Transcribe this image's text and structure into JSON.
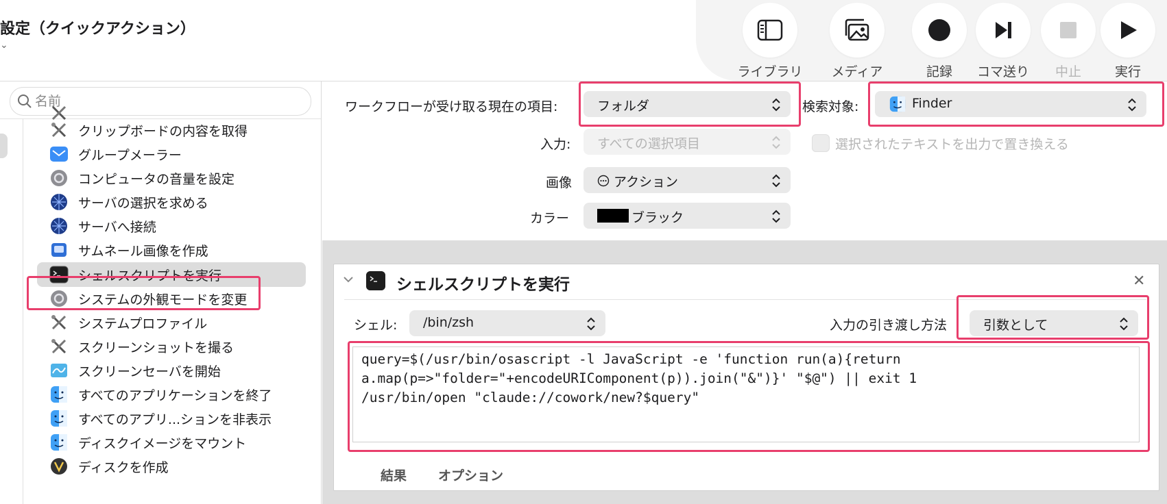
{
  "window": {
    "title": "設定（クイックアクション）",
    "subtitle": "⌄"
  },
  "toolbar": {
    "buttons": [
      {
        "label": "ライブラリ",
        "icon": "sidebar-icon"
      },
      {
        "label": "メディア",
        "icon": "photos-icon"
      },
      {
        "label": "記録",
        "icon": "record-icon"
      },
      {
        "label": "コマ送り",
        "icon": "step-icon"
      },
      {
        "label": "中止",
        "icon": "stop-icon",
        "disabled": true
      },
      {
        "label": "実行",
        "icon": "play-icon"
      }
    ]
  },
  "library": {
    "search_placeholder": "名前",
    "items": [
      {
        "label": "クリップボードの内容を取得",
        "icon": "utility-tools-icon"
      },
      {
        "label": "グループメーラー",
        "icon": "mail-icon"
      },
      {
        "label": "コンピュータの音量を設定",
        "icon": "system-preferences-icon"
      },
      {
        "label": "サーバの選択を求める",
        "icon": "network-globe-icon"
      },
      {
        "label": "サーバへ接続",
        "icon": "network-globe-icon"
      },
      {
        "label": "サムネール画像を作成",
        "icon": "preview-icon"
      },
      {
        "label": "シェルスクリプトを実行",
        "icon": "terminal-icon",
        "selected": true
      },
      {
        "label": "システムの外観モードを変更",
        "icon": "system-preferences-icon"
      },
      {
        "label": "システムプロファイル",
        "icon": "utility-tools-icon"
      },
      {
        "label": "スクリーンショットを撮る",
        "icon": "utility-tools-icon"
      },
      {
        "label": "スクリーンセーバを開始",
        "icon": "screensaver-icon"
      },
      {
        "label": "すべてのアプリケーションを終了",
        "icon": "finder-icon"
      },
      {
        "label": "すべてのアプリ...ションを非表示",
        "icon": "finder-icon"
      },
      {
        "label": "ディスクイメージをマウント",
        "icon": "finder-icon"
      },
      {
        "label": "ディスクを作成",
        "icon": "disk-utility-icon"
      }
    ]
  },
  "workflow": {
    "receives_label": "ワークフローが受け取る現在の項目:",
    "receives_value": "フォルダ",
    "in_label": "検索対象:",
    "in_value": "Finder",
    "input_label": "入力:",
    "input_value": "すべての選択項目",
    "replace_label": "選択されたテキストを出力で置き換える",
    "image_label": "画像",
    "image_value": "アクション",
    "color_label": "カラー",
    "color_value": "ブラック",
    "color_swatch": "#000000"
  },
  "action": {
    "title": "シェルスクリプトを実行",
    "shell_label": "シェル:",
    "shell_value": "/bin/zsh",
    "pass_label": "入力の引き渡し方法",
    "pass_value": "引数として",
    "script": "query=$(/usr/bin/osascript -l JavaScript -e 'function run(a){return\na.map(p=>\"folder=\"+encodeURIComponent(p)).join(\"&\")}' \"$@\") || exit 1\n/usr/bin/open \"claude://cowork/new?$query\"",
    "tab_results": "結果",
    "tab_options": "オプション"
  },
  "colors": {
    "highlight": "#e83e6c",
    "card_bg": "#ffffff",
    "workflow_bg": "#dddddd"
  }
}
